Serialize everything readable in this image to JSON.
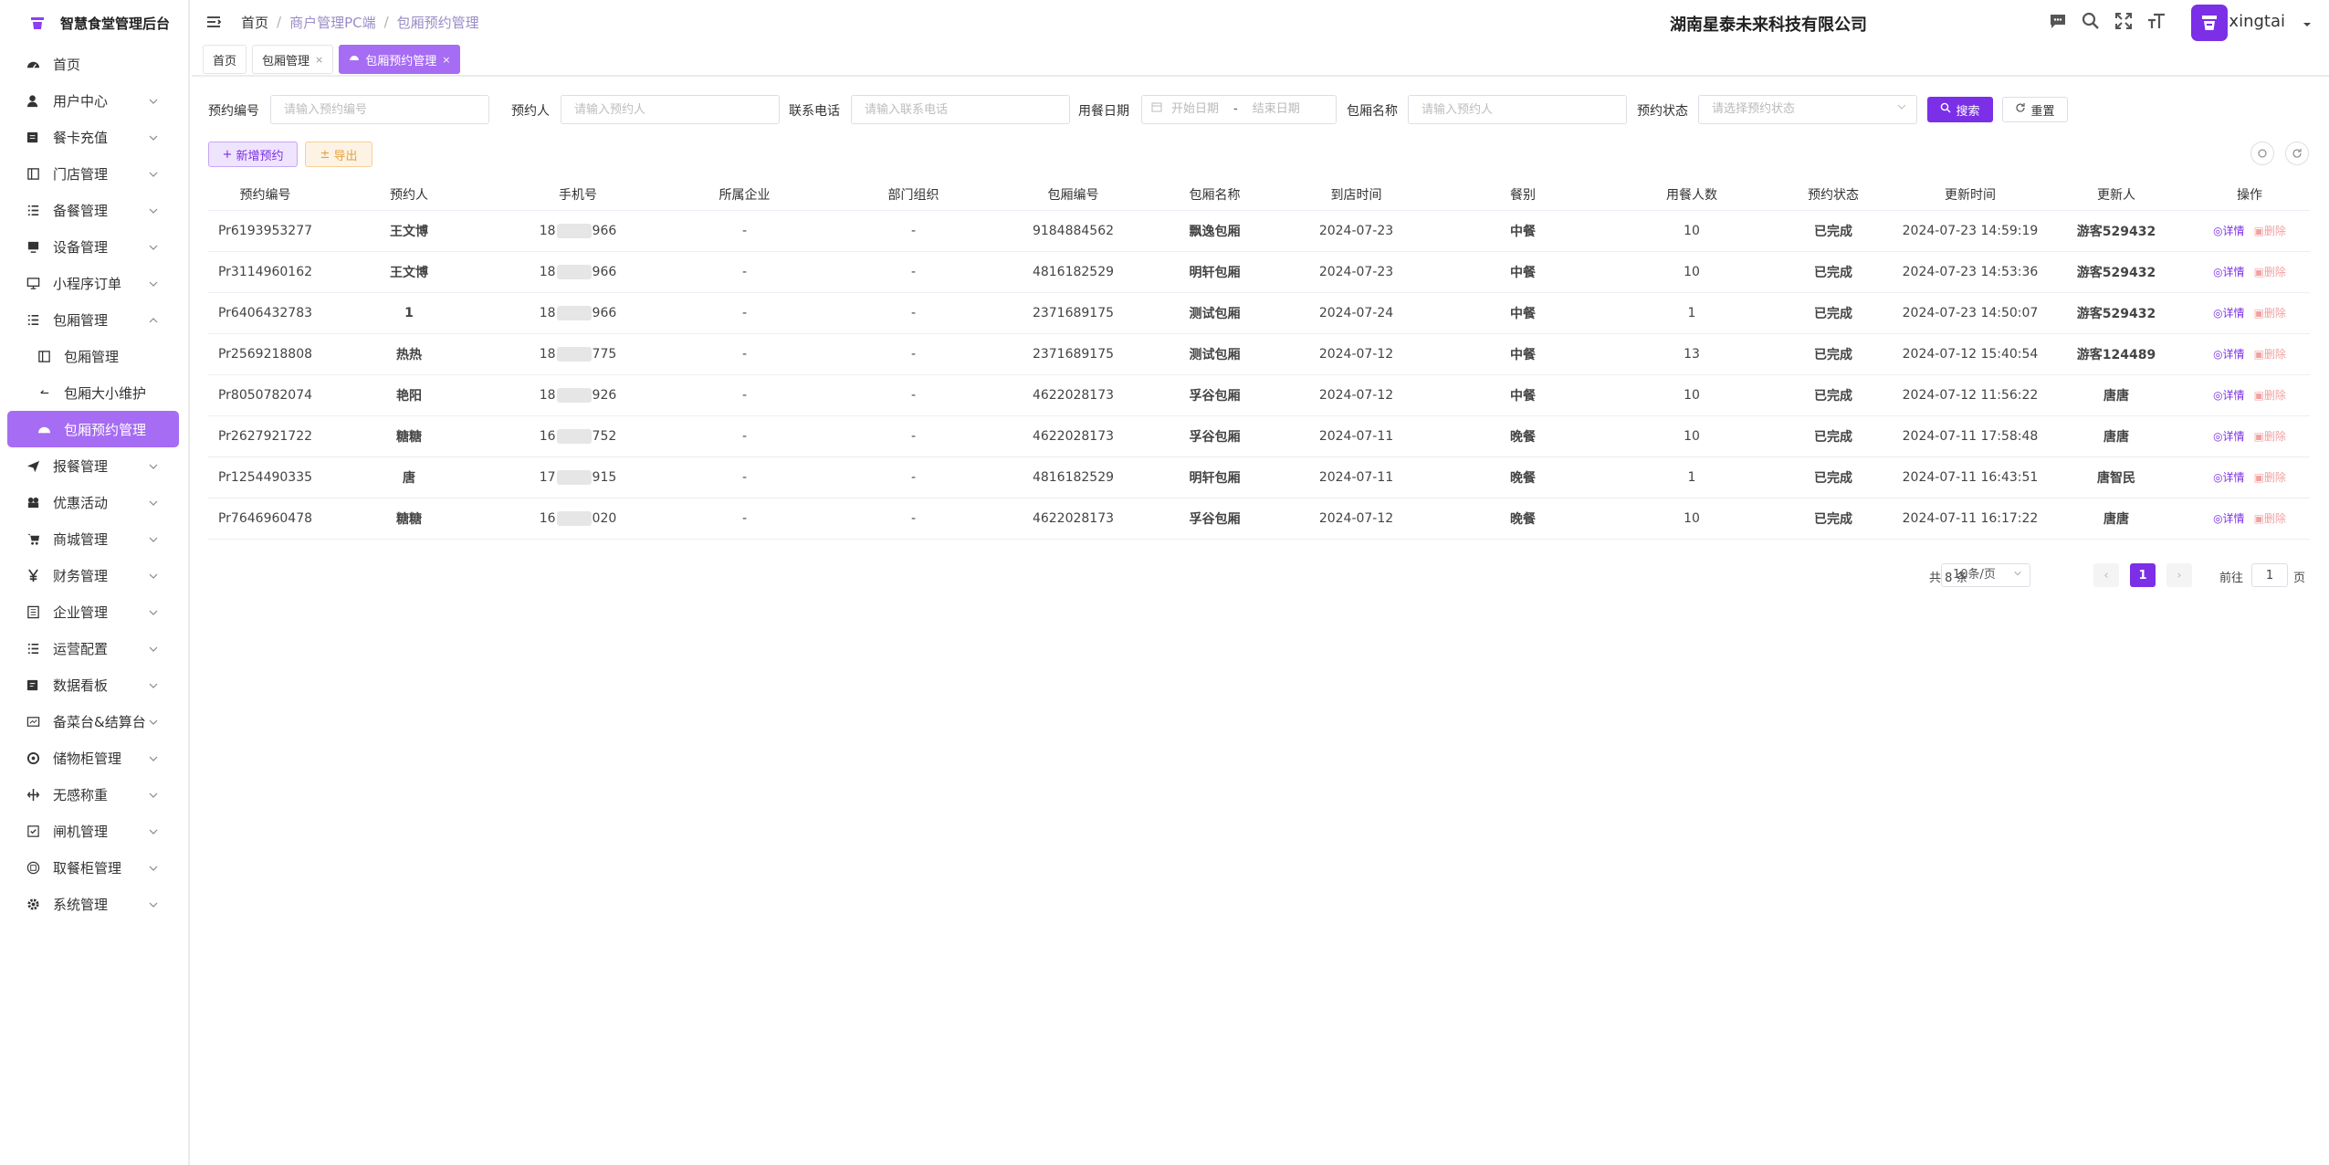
{
  "app": {
    "title": "智慧食堂管理后台",
    "company": "湖南星泰未来科技有限公司",
    "username": "xingtai"
  },
  "colors": {
    "accent": "#7b2fe6",
    "accent_light": "#a66cf3",
    "warning": "#e6a23c",
    "danger": "#f2a1a1"
  },
  "sidebar": {
    "items": [
      {
        "label": "首页",
        "icon": "dashboard-icon"
      },
      {
        "label": "用户中心",
        "icon": "user-icon"
      },
      {
        "label": "餐卡充值",
        "icon": "card-icon"
      },
      {
        "label": "门店管理",
        "icon": "store-icon"
      },
      {
        "label": "备餐管理",
        "icon": "list-icon"
      },
      {
        "label": "设备管理",
        "icon": "device-icon"
      },
      {
        "label": "小程序订单",
        "icon": "miniapp-icon"
      },
      {
        "label": "包厢管理",
        "icon": "list-icon"
      },
      {
        "label": "包厢管理",
        "icon": "store-icon"
      },
      {
        "label": "包厢大小维护",
        "icon": "back-arrow-icon"
      },
      {
        "label": "包厢预约管理",
        "icon": "dashboard-icon"
      },
      {
        "label": "报餐管理",
        "icon": "send-icon"
      },
      {
        "label": "优惠活动",
        "icon": "gift-icon"
      },
      {
        "label": "商城管理",
        "icon": "cart-icon"
      },
      {
        "label": "财务管理",
        "icon": "yen-icon"
      },
      {
        "label": "企业管理",
        "icon": "building-icon"
      },
      {
        "label": "运营配置",
        "icon": "list-icon"
      },
      {
        "label": "数据看板",
        "icon": "board-icon"
      },
      {
        "label": "备菜台&结算台",
        "icon": "counter-icon"
      },
      {
        "label": "储物柜管理",
        "icon": "locker-icon"
      },
      {
        "label": "无感称重",
        "icon": "scale-icon"
      },
      {
        "label": "闸机管理",
        "icon": "gate-icon"
      },
      {
        "label": "取餐柜管理",
        "icon": "cabinet-icon"
      },
      {
        "label": "系统管理",
        "icon": "gear-icon"
      }
    ]
  },
  "breadcrumb": [
    "首页",
    "商户管理PC端",
    "包厢预约管理"
  ],
  "tabs": [
    "首页",
    "包厢管理",
    "包厢预约管理"
  ],
  "filters": {
    "reservation_no": {
      "label": "预约编号",
      "placeholder": "请输入预约编号"
    },
    "reserver": {
      "label": "预约人",
      "placeholder": "请输入预约人"
    },
    "phone": {
      "label": "联系电话",
      "placeholder": "请输入联系电话"
    },
    "date": {
      "label": "用餐日期",
      "start_placeholder": "开始日期",
      "sep": "-",
      "end_placeholder": "结束日期"
    },
    "room_name": {
      "label": "包厢名称",
      "placeholder": "请输入预约人"
    },
    "status": {
      "label": "预约状态",
      "placeholder": "请选择预约状态"
    },
    "search": "搜索",
    "reset": "重置"
  },
  "actions": {
    "add": "新增预约",
    "export": "导出"
  },
  "table": {
    "headers": [
      "预约编号",
      "预约人",
      "手机号",
      "所属企业",
      "部门组织",
      "包厢编号",
      "包厢名称",
      "到店时间",
      "餐别",
      "用餐人数",
      "预约状态",
      "更新时间",
      "更新人",
      "操作"
    ],
    "rows": [
      {
        "no": "Pr6193953277",
        "name": "王文博",
        "phone_pre": "18",
        "phone_post": "966",
        "company": "-",
        "dept": "-",
        "room_no": "9184884562",
        "room_name": "飘逸包厢",
        "date": "2024-07-23",
        "meal": "中餐",
        "count": "10",
        "status": "已完成",
        "updated": "2024-07-23 14:59:19",
        "updater": "游客529432"
      },
      {
        "no": "Pr3114960162",
        "name": "王文博",
        "phone_pre": "18",
        "phone_post": "966",
        "company": "-",
        "dept": "-",
        "room_no": "4816182529",
        "room_name": "明轩包厢",
        "date": "2024-07-23",
        "meal": "中餐",
        "count": "10",
        "status": "已完成",
        "updated": "2024-07-23 14:53:36",
        "updater": "游客529432"
      },
      {
        "no": "Pr6406432783",
        "name": "1",
        "phone_pre": "18",
        "phone_post": "966",
        "company": "-",
        "dept": "-",
        "room_no": "2371689175",
        "room_name": "测试包厢",
        "date": "2024-07-24",
        "meal": "中餐",
        "count": "1",
        "status": "已完成",
        "updated": "2024-07-23 14:50:07",
        "updater": "游客529432"
      },
      {
        "no": "Pr2569218808",
        "name": "热热",
        "phone_pre": "18",
        "phone_post": "775",
        "company": "-",
        "dept": "-",
        "room_no": "2371689175",
        "room_name": "测试包厢",
        "date": "2024-07-12",
        "meal": "中餐",
        "count": "13",
        "status": "已完成",
        "updated": "2024-07-12 15:40:54",
        "updater": "游客124489"
      },
      {
        "no": "Pr8050782074",
        "name": "艳阳",
        "phone_pre": "18",
        "phone_post": "926",
        "company": "-",
        "dept": "-",
        "room_no": "4622028173",
        "room_name": "孚谷包厢",
        "date": "2024-07-12",
        "meal": "中餐",
        "count": "10",
        "status": "已完成",
        "updated": "2024-07-12 11:56:22",
        "updater": "唐唐"
      },
      {
        "no": "Pr2627921722",
        "name": "糖糖",
        "phone_pre": "16",
        "phone_post": "752",
        "company": "-",
        "dept": "-",
        "room_no": "4622028173",
        "room_name": "孚谷包厢",
        "date": "2024-07-11",
        "meal": "晚餐",
        "count": "10",
        "status": "已完成",
        "updated": "2024-07-11 17:58:48",
        "updater": "唐唐"
      },
      {
        "no": "Pr1254490335",
        "name": "唐",
        "phone_pre": "17",
        "phone_post": "915",
        "company": "-",
        "dept": "-",
        "room_no": "4816182529",
        "room_name": "明轩包厢",
        "date": "2024-07-11",
        "meal": "晚餐",
        "count": "1",
        "status": "已完成",
        "updated": "2024-07-11 16:43:51",
        "updater": "唐智民"
      },
      {
        "no": "Pr7646960478",
        "name": "糖糖",
        "phone_pre": "16",
        "phone_post": "020",
        "company": "-",
        "dept": "-",
        "room_no": "4622028173",
        "room_name": "孚谷包厢",
        "date": "2024-07-12",
        "meal": "晚餐",
        "count": "10",
        "status": "已完成",
        "updated": "2024-07-11 16:17:22",
        "updater": "唐唐"
      }
    ],
    "op_detail": "详情",
    "op_delete": "删除"
  },
  "pagination": {
    "total": "共 8 条",
    "page_size": "10条/页",
    "current": "1",
    "goto_label": "前往",
    "goto_value": "1",
    "goto_suffix": "页"
  }
}
